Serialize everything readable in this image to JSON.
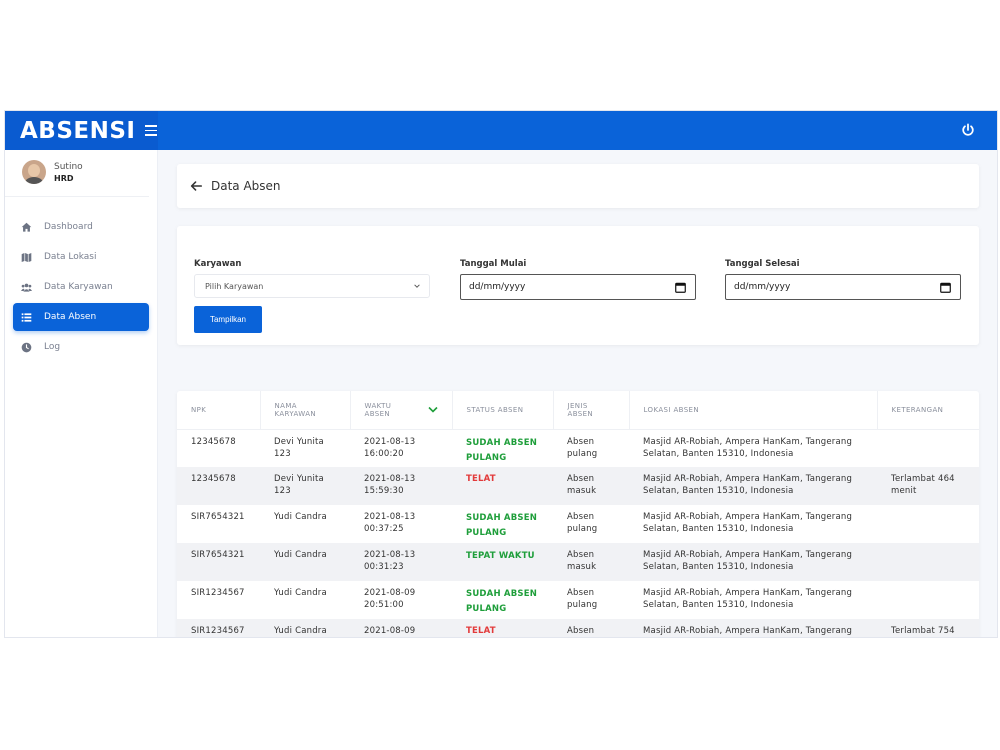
{
  "app": {
    "brand": "ABSENSI"
  },
  "user": {
    "name": "Sutino",
    "role": "HRD"
  },
  "sidebar": {
    "items": [
      {
        "label": "Dashboard",
        "icon": "home-icon",
        "active": false
      },
      {
        "label": "Data Lokasi",
        "icon": "map-icon",
        "active": false
      },
      {
        "label": "Data Karyawan",
        "icon": "users-icon",
        "active": false
      },
      {
        "label": "Data Absen",
        "icon": "list-icon",
        "active": true
      },
      {
        "label": "Log",
        "icon": "clock-icon",
        "active": false
      }
    ]
  },
  "header": {
    "title": "Data Absen"
  },
  "filter": {
    "employee_label": "Karyawan",
    "employee_value": "Pilih Karyawan",
    "start_label": "Tanggal Mulai",
    "start_value": "dd/mm/yyyy",
    "end_label": "Tanggal Selesai",
    "end_value": "dd/mm/yyyy",
    "submit_label": "Tampilkan"
  },
  "table": {
    "columns": [
      {
        "l1": "NPK",
        "l2": ""
      },
      {
        "l1": "NAMA",
        "l2": "KARYAWAN"
      },
      {
        "l1": "WAKTU",
        "l2": "ABSEN"
      },
      {
        "l1": "STATUS ABSEN",
        "l2": ""
      },
      {
        "l1": "JENIS",
        "l2": "ABSEN"
      },
      {
        "l1": "LOKASI ABSEN",
        "l2": ""
      },
      {
        "l1": "KETERANGAN",
        "l2": ""
      }
    ],
    "rows": [
      {
        "npk": "12345678",
        "name_1": "Devi Yunita",
        "name_2": "123",
        "time_1": "2021-08-13",
        "time_2": "16:00:20",
        "status_1": "SUDAH ABSEN",
        "status_2": "PULANG",
        "status_color": "green",
        "type_1": "Absen",
        "type_2": "pulang",
        "loc_1": "Masjid AR-Robiah, Ampera HanKam, Tangerang",
        "loc_2": "Selatan, Banten 15310, Indonesia",
        "note_1": "",
        "note_2": ""
      },
      {
        "npk": "12345678",
        "name_1": "Devi Yunita",
        "name_2": "123",
        "time_1": "2021-08-13",
        "time_2": "15:59:30",
        "status_1": "TELAT",
        "status_2": "",
        "status_color": "red",
        "type_1": "Absen",
        "type_2": "masuk",
        "loc_1": "Masjid AR-Robiah, Ampera HanKam, Tangerang",
        "loc_2": "Selatan, Banten 15310, Indonesia",
        "note_1": "Terlambat 464",
        "note_2": "menit"
      },
      {
        "npk": "SIR7654321",
        "name_1": "Yudi Candra",
        "name_2": "",
        "time_1": "2021-08-13",
        "time_2": "00:37:25",
        "status_1": "SUDAH ABSEN",
        "status_2": "PULANG",
        "status_color": "green",
        "type_1": "Absen",
        "type_2": "pulang",
        "loc_1": "Masjid AR-Robiah, Ampera HanKam, Tangerang",
        "loc_2": "Selatan, Banten 15310, Indonesia",
        "note_1": "",
        "note_2": ""
      },
      {
        "npk": "SIR7654321",
        "name_1": "Yudi Candra",
        "name_2": "",
        "time_1": "2021-08-13",
        "time_2": "00:31:23",
        "status_1": "TEPAT WAKTU",
        "status_2": "",
        "status_color": "green",
        "type_1": "Absen",
        "type_2": "masuk",
        "loc_1": "Masjid AR-Robiah, Ampera HanKam, Tangerang",
        "loc_2": "Selatan, Banten 15310, Indonesia",
        "note_1": "",
        "note_2": ""
      },
      {
        "npk": "SIR1234567",
        "name_1": "Yudi Candra",
        "name_2": "",
        "time_1": "2021-08-09",
        "time_2": "20:51:00",
        "status_1": "SUDAH ABSEN",
        "status_2": "PULANG",
        "status_color": "green",
        "type_1": "Absen",
        "type_2": "pulang",
        "loc_1": "Masjid AR-Robiah, Ampera HanKam, Tangerang",
        "loc_2": "Selatan, Banten 15310, Indonesia",
        "note_1": "",
        "note_2": ""
      },
      {
        "npk": "SIR1234567",
        "name_1": "Yudi Candra",
        "name_2": "",
        "time_1": "2021-08-09",
        "time_2": "",
        "status_1": "TELAT",
        "status_2": "",
        "status_color": "red",
        "type_1": "Absen",
        "type_2": "",
        "loc_1": "Masjid AR-Robiah, Ampera HanKam, Tangerang",
        "loc_2": "",
        "note_1": "Terlambat 754",
        "note_2": ""
      }
    ]
  },
  "colors": {
    "primary": "#0a63d9",
    "status_green": "#1e9e3a",
    "status_red": "#e23a3a"
  }
}
